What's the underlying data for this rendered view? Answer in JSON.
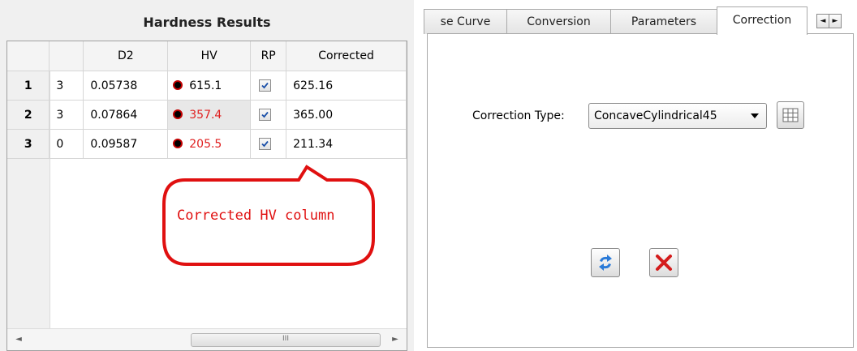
{
  "results": {
    "title": "Hardness Results",
    "columns": [
      "",
      "",
      "D2",
      "HV",
      "RP",
      "Corrected"
    ],
    "rows": [
      {
        "index": "1",
        "n": "3",
        "d2": "0.05738",
        "hv": "615.1",
        "hv_color": "#000000",
        "rp_checked": true,
        "corrected": "625.16"
      },
      {
        "index": "2",
        "n": "3",
        "d2": "0.07864",
        "hv": "357.4",
        "hv_color": "#e02020",
        "rp_checked": true,
        "corrected": "365.00"
      },
      {
        "index": "3",
        "n": "0",
        "d2": "0.09587",
        "hv": "205.5",
        "hv_color": "#e02020",
        "rp_checked": true,
        "corrected": "211.34"
      }
    ],
    "scrollbar": {
      "left_arrow": "◄",
      "right_arrow": "►",
      "thumb_grip": "III"
    },
    "callout": "Corrected HV column"
  },
  "tabs": {
    "items": [
      {
        "label": "se Curve",
        "active": false
      },
      {
        "label": "Conversion",
        "active": false
      },
      {
        "label": "Parameters",
        "active": false
      },
      {
        "label": "Correction",
        "active": true
      }
    ],
    "scroll_left": "◄",
    "scroll_right": "►"
  },
  "correction": {
    "label": "Correction Type:",
    "selected": "ConcaveCylindrical45",
    "grid_icon": "table-grid-icon",
    "refresh_icon": "refresh-arrows-icon",
    "cancel_icon": "red-x-icon"
  },
  "colors": {
    "warning_text": "#e02020",
    "callout_border": "#e01010",
    "refresh_icon": "#2a7ad8",
    "cancel_icon": "#d41c1c"
  }
}
